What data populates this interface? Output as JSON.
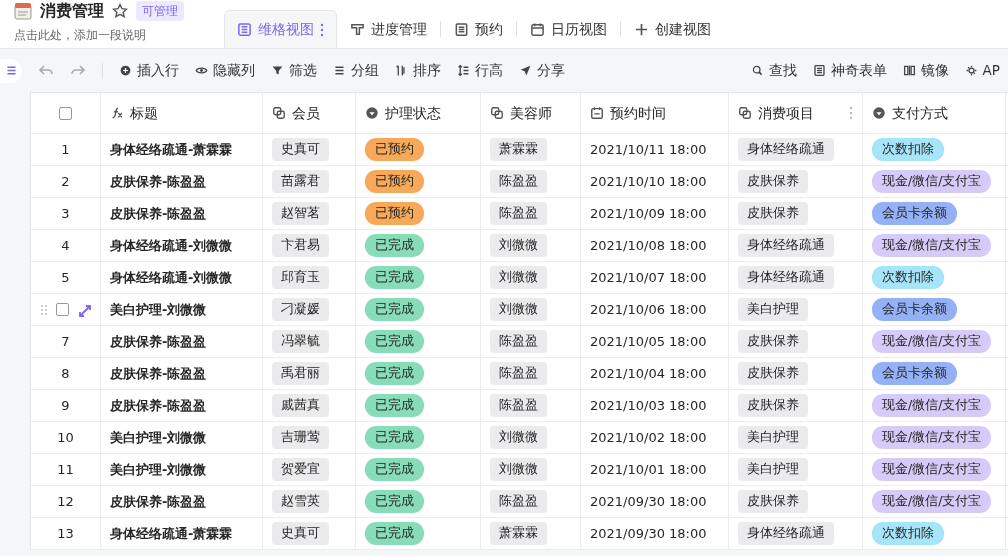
{
  "header": {
    "title": "消费管理",
    "badge": "可管理",
    "description": "点击此处，添加一段说明"
  },
  "tabs": [
    {
      "label": "维格视图",
      "kind": "grid",
      "selected": true
    },
    {
      "label": "进度管理",
      "kind": "kanban",
      "selected": false
    },
    {
      "label": "预约",
      "kind": "form",
      "selected": false
    },
    {
      "label": "日历视图",
      "kind": "calendar",
      "selected": false
    },
    {
      "label": "创建视图",
      "kind": "create",
      "selected": false
    }
  ],
  "toolbar": {
    "left": [
      {
        "label": "插入行",
        "kind": "insert"
      },
      {
        "label": "隐藏列",
        "kind": "hide"
      },
      {
        "label": "筛选",
        "kind": "filter"
      },
      {
        "label": "分组",
        "kind": "group"
      },
      {
        "label": "排序",
        "kind": "sort"
      },
      {
        "label": "行高",
        "kind": "height"
      },
      {
        "label": "分享",
        "kind": "share"
      }
    ],
    "right": [
      {
        "label": "查找",
        "kind": "search"
      },
      {
        "label": "神奇表单",
        "kind": "form"
      },
      {
        "label": "镜像",
        "kind": "mirror"
      },
      {
        "label": "AP",
        "kind": "api"
      }
    ]
  },
  "table": {
    "select_all": {
      "checked": false
    },
    "columns": [
      {
        "label": "标题",
        "kind": "formula"
      },
      {
        "label": "会员",
        "kind": "link"
      },
      {
        "label": "护理状态",
        "kind": "select"
      },
      {
        "label": "美容师",
        "kind": "link"
      },
      {
        "label": "预约时间",
        "kind": "date"
      },
      {
        "label": "消费项目",
        "kind": "link",
        "menu": true
      },
      {
        "label": "支付方式",
        "kind": "select"
      }
    ],
    "rows": [
      {
        "number": "1",
        "hovered": false,
        "title": "身体经络疏通-萧霖霖",
        "member": "史真可",
        "status": {
          "label": "已预约",
          "color": "#f7a95a"
        },
        "beautician": "萧霖霖",
        "time": "2021/10/11 18:00",
        "item": "身体经络疏通",
        "payment": {
          "label": "次数扣除",
          "color": "#a6e4f7"
        }
      },
      {
        "number": "2",
        "hovered": false,
        "title": "皮肤保养-陈盈盈",
        "member": "苗露君",
        "status": {
          "label": "已预约",
          "color": "#f7a95a"
        },
        "beautician": "陈盈盈",
        "time": "2021/10/10 18:00",
        "item": "皮肤保养",
        "payment": {
          "label": "现金/微信/支付宝",
          "color": "#d6cbf8"
        }
      },
      {
        "number": "3",
        "hovered": false,
        "title": "皮肤保养-陈盈盈",
        "member": "赵智茗",
        "status": {
          "label": "已预约",
          "color": "#f7a95a"
        },
        "beautician": "陈盈盈",
        "time": "2021/10/09 18:00",
        "item": "皮肤保养",
        "payment": {
          "label": "会员卡余额",
          "color": "#95b1f6"
        }
      },
      {
        "number": "4",
        "hovered": false,
        "title": "身体经络疏通-刘微微",
        "member": "卞君易",
        "status": {
          "label": "已完成",
          "color": "#88dcb8"
        },
        "beautician": "刘微微",
        "time": "2021/10/08 18:00",
        "item": "身体经络疏通",
        "payment": {
          "label": "现金/微信/支付宝",
          "color": "#d6cbf8"
        }
      },
      {
        "number": "5",
        "hovered": false,
        "title": "身体经络疏通-刘微微",
        "member": "邱育玉",
        "status": {
          "label": "已完成",
          "color": "#88dcb8"
        },
        "beautician": "刘微微",
        "time": "2021/10/07 18:00",
        "item": "身体经络疏通",
        "payment": {
          "label": "次数扣除",
          "color": "#a6e4f7"
        }
      },
      {
        "hovered": true,
        "checked": false,
        "title": "美白护理-刘微微",
        "member": "刁凝媛",
        "status": {
          "label": "已完成",
          "color": "#88dcb8"
        },
        "beautician": "刘微微",
        "time": "2021/10/06 18:00",
        "item": "美白护理",
        "payment": {
          "label": "会员卡余额",
          "color": "#95b1f6"
        }
      },
      {
        "number": "7",
        "hovered": false,
        "title": "皮肤保养-陈盈盈",
        "member": "冯翠毓",
        "status": {
          "label": "已完成",
          "color": "#88dcb8"
        },
        "beautician": "陈盈盈",
        "time": "2021/10/05 18:00",
        "item": "皮肤保养",
        "payment": {
          "label": "现金/微信/支付宝",
          "color": "#d6cbf8"
        }
      },
      {
        "number": "8",
        "hovered": false,
        "title": "皮肤保养-陈盈盈",
        "member": "禹君丽",
        "status": {
          "label": "已完成",
          "color": "#88dcb8"
        },
        "beautician": "陈盈盈",
        "time": "2021/10/04 18:00",
        "item": "皮肤保养",
        "payment": {
          "label": "会员卡余额",
          "color": "#95b1f6"
        }
      },
      {
        "number": "9",
        "hovered": false,
        "title": "皮肤保养-陈盈盈",
        "member": "戚茜真",
        "status": {
          "label": "已完成",
          "color": "#88dcb8"
        },
        "beautician": "陈盈盈",
        "time": "2021/10/03 18:00",
        "item": "皮肤保养",
        "payment": {
          "label": "现金/微信/支付宝",
          "color": "#d6cbf8"
        }
      },
      {
        "number": "10",
        "hovered": false,
        "title": "美白护理-刘微微",
        "member": "吉珊莺",
        "status": {
          "label": "已完成",
          "color": "#88dcb8"
        },
        "beautician": "刘微微",
        "time": "2021/10/02 18:00",
        "item": "美白护理",
        "payment": {
          "label": "现金/微信/支付宝",
          "color": "#d6cbf8"
        }
      },
      {
        "number": "11",
        "hovered": false,
        "title": "美白护理-刘微微",
        "member": "贺爱宜",
        "status": {
          "label": "已完成",
          "color": "#88dcb8"
        },
        "beautician": "刘微微",
        "time": "2021/10/01 18:00",
        "item": "美白护理",
        "payment": {
          "label": "现金/微信/支付宝",
          "color": "#d6cbf8"
        }
      },
      {
        "number": "12",
        "hovered": false,
        "title": "皮肤保养-陈盈盈",
        "member": "赵雪英",
        "status": {
          "label": "已完成",
          "color": "#88dcb8"
        },
        "beautician": "陈盈盈",
        "time": "2021/09/30 18:00",
        "item": "皮肤保养",
        "payment": {
          "label": "现金/微信/支付宝",
          "color": "#d6cbf8"
        }
      },
      {
        "number": "13",
        "hovered": false,
        "title": "身体经络疏通-萧霖霖",
        "member": "史真可",
        "status": {
          "label": "已完成",
          "color": "#88dcb8"
        },
        "beautician": "萧霖霖",
        "time": "2021/09/30 18:00",
        "item": "身体经络疏通",
        "payment": {
          "label": "次数扣除",
          "color": "#a6e4f7"
        }
      }
    ]
  }
}
